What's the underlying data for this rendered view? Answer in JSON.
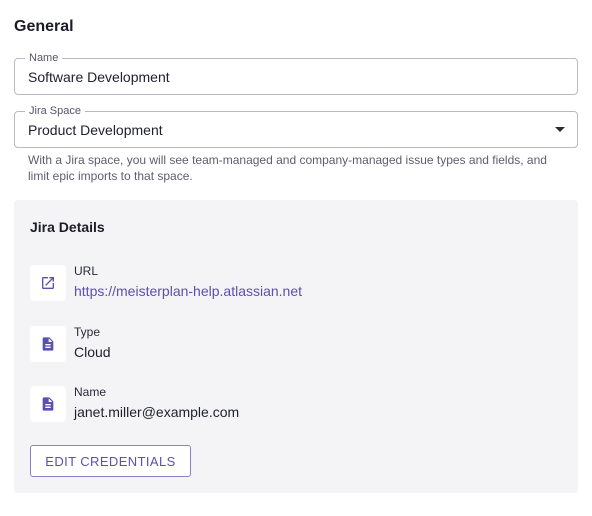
{
  "general": {
    "title": "General",
    "name_field": {
      "label": "Name",
      "value": "Software Development"
    },
    "space_field": {
      "label": "Jira Space",
      "value": "Product Development",
      "helper": "With a Jira space, you will see team-managed and company-managed issue types and fields, and limit epic imports to that space."
    }
  },
  "jira_details": {
    "title": "Jira Details",
    "url": {
      "label": "URL",
      "value": "https://meisterplan-help.atlassian.net",
      "icon": "external-link-icon"
    },
    "type": {
      "label": "Type",
      "value": "Cloud",
      "icon": "document-icon"
    },
    "name": {
      "label": "Name",
      "value": "janet.miller@example.com",
      "icon": "document-icon"
    },
    "edit_button_label": "EDIT CREDENTIALS"
  },
  "colors": {
    "accent": "#5b4fb0",
    "card_background": "#f4f4f6"
  }
}
